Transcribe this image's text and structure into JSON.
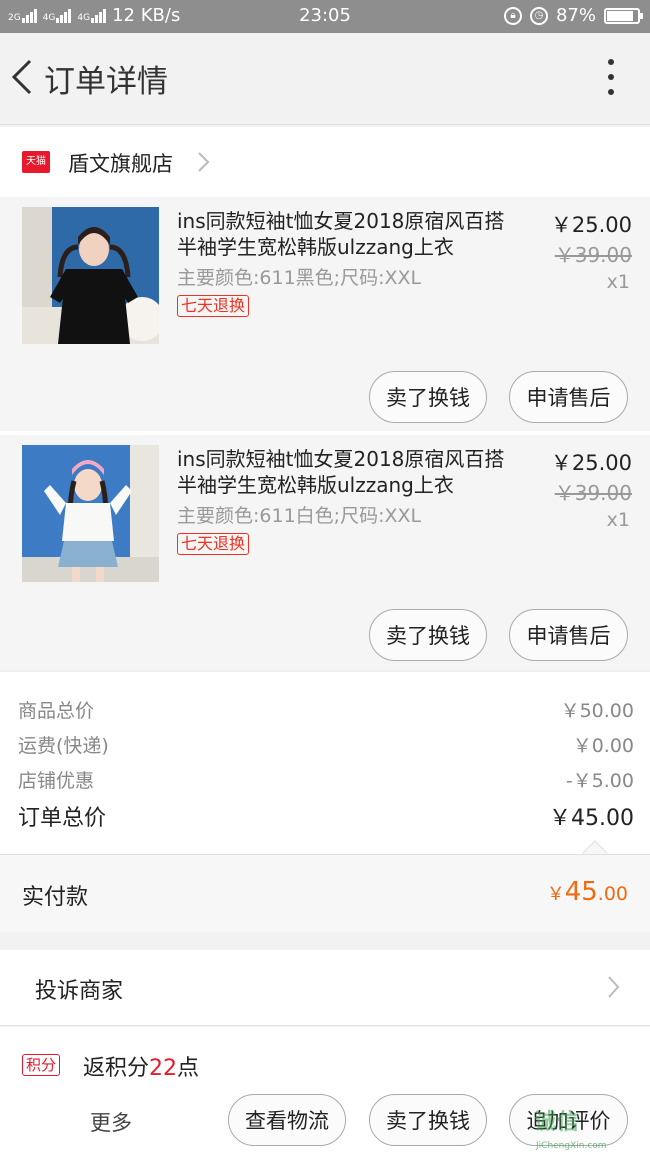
{
  "status_bar": {
    "net1": "2G",
    "net2": "4G",
    "net3": "4G",
    "speed": "12 KB/s",
    "time": "23:05",
    "battery_percent": "87%",
    "battery_level": 0.87
  },
  "header": {
    "title": "订单详情"
  },
  "shop": {
    "badge": "天猫",
    "name": "盾文旗舰店"
  },
  "items": [
    {
      "title": "ins同款短袖t恤女夏2018原宿风百搭半袖学生宽松韩版ulzzang上衣",
      "sku": "主要颜色:611黑色;尺码:XXL",
      "tag": "七天退换",
      "price": "￥25.00",
      "original_price": "￥39.00",
      "qty": "x1",
      "btn_sell": "卖了换钱",
      "btn_aftersale": "申请售后"
    },
    {
      "title": "ins同款短袖t恤女夏2018原宿风百搭半袖学生宽松韩版ulzzang上衣",
      "sku": "主要颜色:611白色;尺码:XXL",
      "tag": "七天退换",
      "price": "￥25.00",
      "original_price": "￥39.00",
      "qty": "x1",
      "btn_sell": "卖了换钱",
      "btn_aftersale": "申请售后"
    }
  ],
  "totals": {
    "goods_label": "商品总价",
    "goods_value": "￥50.00",
    "shipping_label": "运费(快递)",
    "shipping_value": "￥0.00",
    "discount_label": "店铺优惠",
    "discount_value": "-￥5.00",
    "order_label": "订单总价",
    "order_value": "￥45.00"
  },
  "paid": {
    "label": "实付款",
    "currency": "￥",
    "integer": "45",
    "decimal": ".00"
  },
  "complain": {
    "label": "投诉商家"
  },
  "points": {
    "badge": "积分",
    "prefix": "返积分",
    "number": "22",
    "suffix": "点"
  },
  "bottom": {
    "more": "更多",
    "logistics": "查看物流",
    "sell": "卖了换钱",
    "review": "追加评价"
  },
  "watermark": {
    "text": "诚信",
    "url_text": "JiChengXin.com"
  },
  "colors": {
    "accent_orange": "#f26a10",
    "tmall_red": "#e8192c"
  }
}
